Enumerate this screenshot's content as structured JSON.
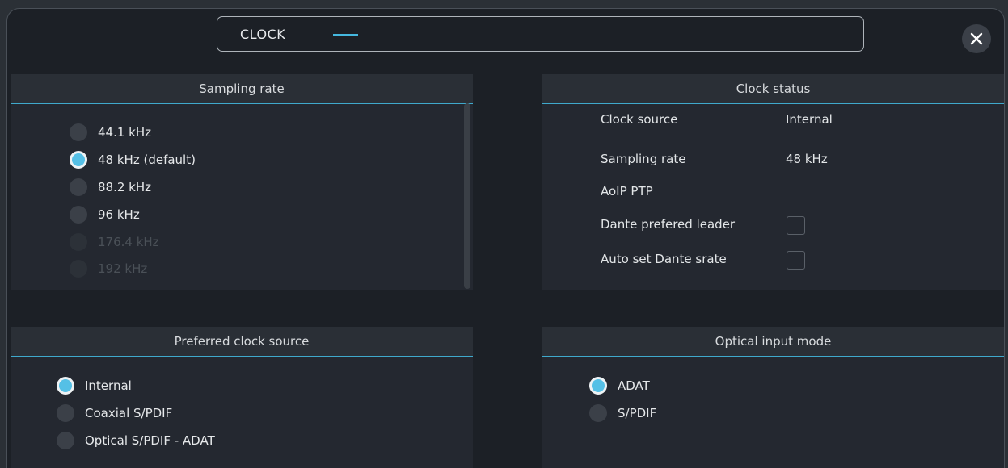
{
  "window": {
    "title": "CLOCK"
  },
  "sampling_rate": {
    "header": "Sampling rate",
    "options": [
      {
        "label": "44.1 kHz",
        "selected": false,
        "enabled": true
      },
      {
        "label": "48 kHz (default)",
        "selected": true,
        "enabled": true
      },
      {
        "label": "88.2 kHz",
        "selected": false,
        "enabled": true
      },
      {
        "label": "96 kHz",
        "selected": false,
        "enabled": true
      },
      {
        "label": "176.4 kHz",
        "selected": false,
        "enabled": false
      },
      {
        "label": "192 kHz",
        "selected": false,
        "enabled": false
      }
    ]
  },
  "clock_status": {
    "header": "Clock status",
    "clock_source_label": "Clock source",
    "clock_source_value": "Internal",
    "sampling_rate_label": "Sampling rate",
    "sampling_rate_value": "48 kHz",
    "aoip_ptp_label": "AoIP PTP",
    "dante_leader_label": "Dante prefered leader",
    "dante_leader_checked": false,
    "auto_set_label": "Auto set Dante srate",
    "auto_set_checked": false
  },
  "preferred_clock": {
    "header": "Preferred clock source",
    "options": [
      {
        "label": "Internal",
        "selected": true
      },
      {
        "label": "Coaxial S/PDIF",
        "selected": false
      },
      {
        "label": "Optical S/PDIF - ADAT",
        "selected": false
      }
    ]
  },
  "optical_input": {
    "header": "Optical input mode",
    "options": [
      {
        "label": "ADAT",
        "selected": true
      },
      {
        "label": "S/PDIF",
        "selected": false
      }
    ]
  },
  "colors": {
    "accent": "#55c0e6",
    "background": "#1c2026",
    "panel": "#242830"
  },
  "icons": {
    "close": "close-icon"
  }
}
